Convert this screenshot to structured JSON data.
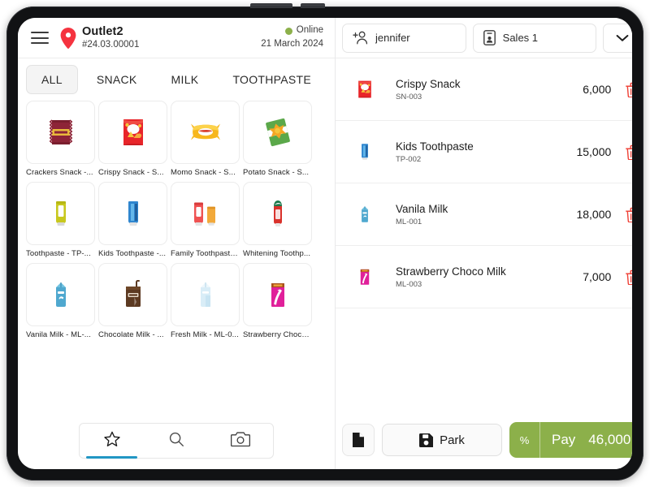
{
  "theme": {
    "accent_green": "#8cb04a",
    "accent_blue": "#2196c4",
    "pin_red": "#f5333f",
    "delete_red": "#ef4136"
  },
  "outlet": {
    "name": "Outlet2",
    "code": "#24.03.00001",
    "status_label": "Online",
    "date": "21 March 2024",
    "menu_icon": "hamburger-menu-icon",
    "location_icon": "map-pin-icon"
  },
  "categories": [
    {
      "label": "ALL",
      "active": true
    },
    {
      "label": "SNACK",
      "active": false
    },
    {
      "label": "MILK",
      "active": false
    },
    {
      "label": "TOOTHPASTE",
      "active": false
    }
  ],
  "products": [
    {
      "label": "Crackers Snack  -...",
      "icon": "crackers-snack-icon"
    },
    {
      "label": "Crispy Snack  -  S...",
      "icon": "crispy-snack-icon"
    },
    {
      "label": "Momo Snack  -  S...",
      "icon": "momo-snack-icon"
    },
    {
      "label": "Potato Snack  -  S...",
      "icon": "potato-snack-icon"
    },
    {
      "label": "Toothpaste  -  TP-...",
      "icon": "toothpaste-icon"
    },
    {
      "label": "Kids Toothpaste  -...",
      "icon": "kids-toothpaste-icon"
    },
    {
      "label": "Family Toothpaste...",
      "icon": "family-toothpaste-icon"
    },
    {
      "label": "Whitening Toothp...",
      "icon": "whitening-toothpaste-icon"
    },
    {
      "label": "Vanila Milk  -  ML-...",
      "icon": "vanila-milk-icon"
    },
    {
      "label": "Chocolate Milk  -  ...",
      "icon": "chocolate-milk-icon"
    },
    {
      "label": "Fresh Milk  -  ML-0...",
      "icon": "fresh-milk-icon"
    },
    {
      "label": "Strawberry Choco ...",
      "icon": "strawberry-choco-milk-icon"
    }
  ],
  "bottom_tabs": [
    {
      "icon": "star-icon",
      "active": true
    },
    {
      "icon": "search-icon",
      "active": false
    },
    {
      "icon": "camera-icon",
      "active": false
    }
  ],
  "cart_header": {
    "customer": "jennifer",
    "customer_icon": "add-person-icon",
    "sales": "Sales 1",
    "sales_icon": "id-card-icon",
    "more_icon": "chevron-down-icon"
  },
  "cart_items": [
    {
      "name": "Crispy Snack",
      "sku": "SN-003",
      "price": "6,000",
      "icon": "crispy-snack-icon"
    },
    {
      "name": "Kids Toothpaste",
      "sku": "TP-002",
      "price": "15,000",
      "icon": "kids-toothpaste-icon"
    },
    {
      "name": "Vanila Milk",
      "sku": "ML-001",
      "price": "18,000",
      "icon": "vanila-milk-icon"
    },
    {
      "name": "Strawberry Choco Milk",
      "sku": "ML-003",
      "price": "7,000",
      "icon": "strawberry-choco-milk-icon"
    }
  ],
  "actions": {
    "note_icon": "document-icon",
    "park_label": "Park",
    "park_icon": "save-disk-icon",
    "discount_label": "%",
    "pay_label": "Pay",
    "pay_total": "46,000"
  }
}
